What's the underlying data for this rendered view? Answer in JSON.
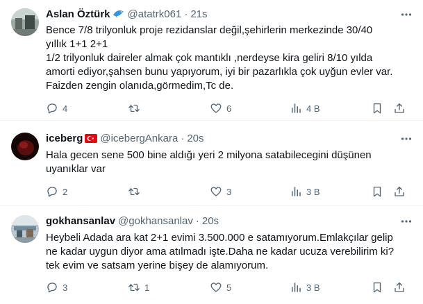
{
  "colors": {
    "text": "#0f1419",
    "muted": "#536471",
    "border": "#eff3f4"
  },
  "tweets": [
    {
      "name": "Aslan Öztürk",
      "badge_icon": "dolphin-emoji",
      "handle": "@atatrk061",
      "time": "21s",
      "text_lines": [
        "Bence 7/8 trilyonluk proje rezidanslar değil,şehirlerin merkezinde 30/40",
        "yıllık 1+1 2+1",
        "1/2 trilyonluk daireler almak çok mantıklı ,nerdeyse kira geliri 8/10 yılda",
        "amorti ediyor,şahsen bunu yapıyorum, iyi bir pazarlıkla çok uyğun evler var.",
        "Faizden zengin olanıda,görmedim,Tc de."
      ],
      "replies": "4",
      "reposts": "",
      "likes": "6",
      "views": "4 B"
    },
    {
      "name": "iceberg",
      "badge_icon": "turkey-flag",
      "handle": "@icebergAnkara",
      "time": "20s",
      "text_lines": [
        "Hala gecen sene 500 bine aldığı yeri 2 milyona satabilecegini düşünen",
        "uyanıklar var"
      ],
      "replies": "2",
      "reposts": "",
      "likes": "3",
      "views": "3 B"
    },
    {
      "name": "gokhansanlav",
      "badge_icon": "",
      "handle": "@gokhansanlav",
      "time": "20s",
      "text_lines": [
        "Heybeli Adada ara kat 2+1 evimi 3.500.000 e satamıyorum.Emlakçılar gelip",
        "ne kadar uygun diyor ama atılmadı işte.Daha ne kadar ucuza verebilirim ki?",
        "tek evim ve satsam yerine bişey de alamıyorum."
      ],
      "replies": "3",
      "reposts": "1",
      "likes": "5",
      "views": "3 B"
    }
  ]
}
